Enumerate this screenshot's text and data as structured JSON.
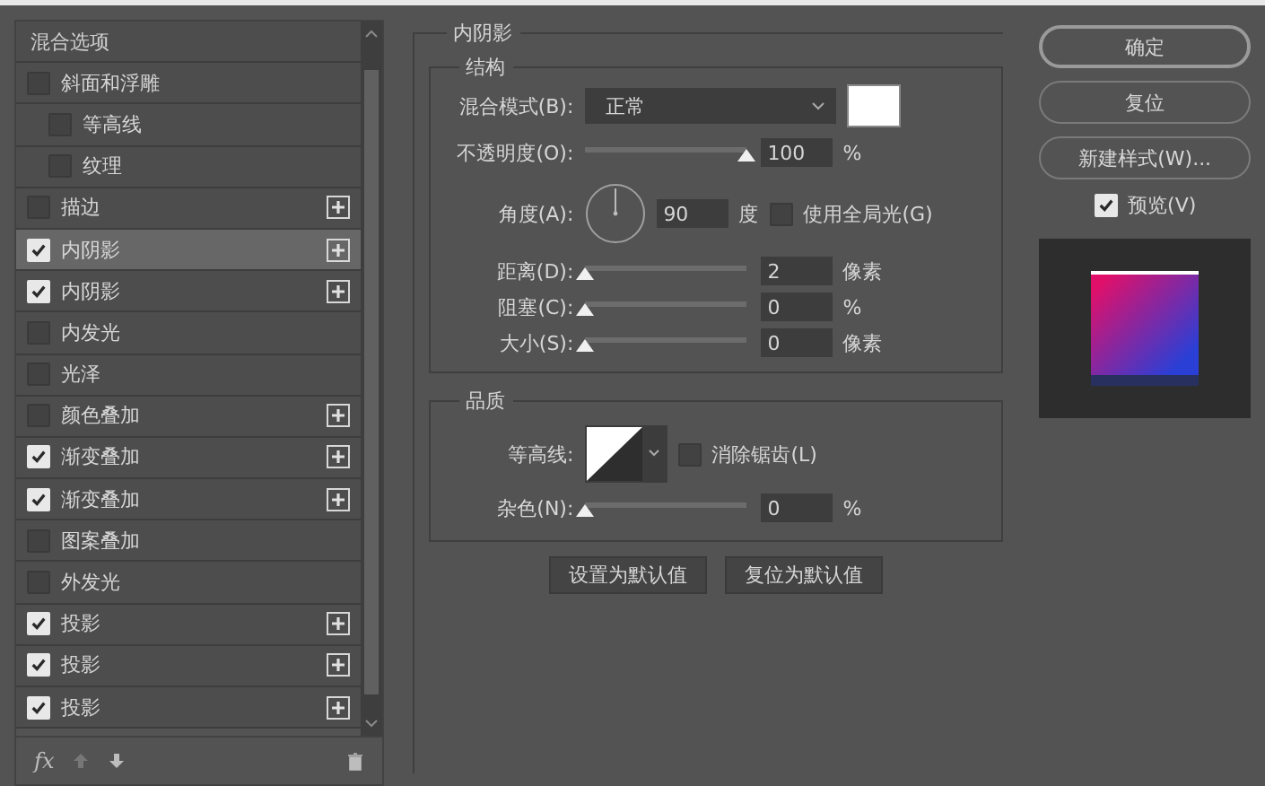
{
  "style_list": {
    "header": "混合选项",
    "items": [
      {
        "label": "斜面和浮雕",
        "checked": false,
        "selected": false,
        "add_button": false,
        "children": [
          {
            "label": "等高线",
            "checked": false,
            "selected": false,
            "add_button": false
          },
          {
            "label": "纹理",
            "checked": false,
            "selected": false,
            "add_button": false
          }
        ]
      },
      {
        "label": "描边",
        "checked": false,
        "selected": false,
        "add_button": true
      },
      {
        "label": "内阴影",
        "checked": true,
        "selected": true,
        "add_button": true
      },
      {
        "label": "内阴影",
        "checked": true,
        "selected": false,
        "add_button": true
      },
      {
        "label": "内发光",
        "checked": false,
        "selected": false,
        "add_button": false
      },
      {
        "label": "光泽",
        "checked": false,
        "selected": false,
        "add_button": false
      },
      {
        "label": "颜色叠加",
        "checked": false,
        "selected": false,
        "add_button": true
      },
      {
        "label": "渐变叠加",
        "checked": true,
        "selected": false,
        "add_button": true
      },
      {
        "label": "渐变叠加",
        "checked": true,
        "selected": false,
        "add_button": true
      },
      {
        "label": "图案叠加",
        "checked": false,
        "selected": false,
        "add_button": false
      },
      {
        "label": "外发光",
        "checked": false,
        "selected": false,
        "add_button": false
      },
      {
        "label": "投影",
        "checked": true,
        "selected": false,
        "add_button": true
      },
      {
        "label": "投影",
        "checked": true,
        "selected": false,
        "add_button": true
      },
      {
        "label": "投影",
        "checked": true,
        "selected": false,
        "add_button": true
      }
    ],
    "fx_label": "fx"
  },
  "settings": {
    "title": "内阴影",
    "structure": {
      "title": "结构",
      "blend_mode": {
        "label": "混合模式(B):",
        "value": "正常",
        "color": "#ffffff"
      },
      "opacity": {
        "label": "不透明度(O):",
        "level": 1,
        "value": "100",
        "unit": "%"
      },
      "angle": {
        "label": "角度(A):",
        "value": "90",
        "unit": "度",
        "global_light": {
          "label": "使用全局光(G)",
          "checked": false
        }
      },
      "sliders": [
        {
          "label": "距离(D):",
          "level": 0,
          "value": "2",
          "unit": "像素"
        },
        {
          "label": "阻塞(C):",
          "level": 0,
          "value": "0",
          "unit": "%"
        },
        {
          "label": "大小(S):",
          "level": 0,
          "value": "0",
          "unit": "像素"
        }
      ]
    },
    "quality": {
      "title": "品质",
      "contour": {
        "label": "等高线:",
        "anti_alias": {
          "label": "消除锯齿(L)",
          "checked": false
        }
      },
      "noise": {
        "label": "杂色(N):",
        "level": 0,
        "value": "0",
        "unit": "%"
      }
    },
    "buttons": [
      "设置为默认值",
      "复位为默认值"
    ]
  },
  "actions": {
    "buttons": [
      "确定",
      "复位",
      "新建样式(W)..."
    ],
    "preview": {
      "label": "预览(V)",
      "checked": true
    }
  }
}
